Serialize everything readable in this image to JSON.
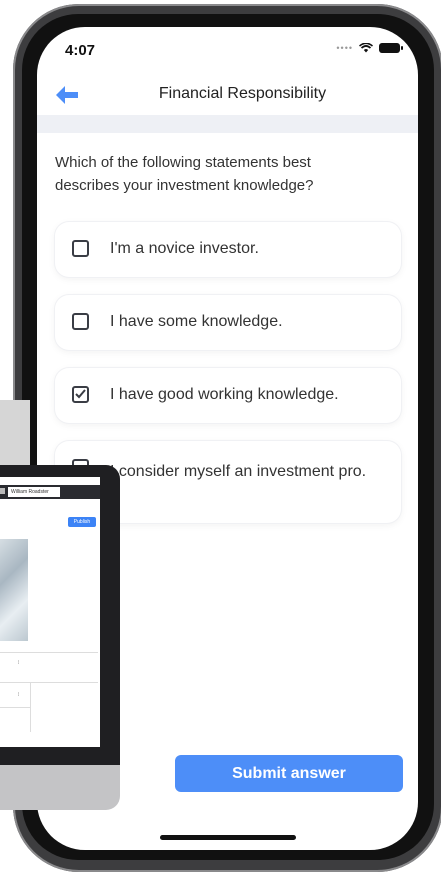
{
  "status_bar": {
    "time": "4:07"
  },
  "header": {
    "title": "Financial Responsibility"
  },
  "question": "Which of the following statements best describes your investment knowledge?",
  "options": [
    {
      "label": "I'm a novice investor.",
      "checked": false
    },
    {
      "label": "I have some knowledge.",
      "checked": false
    },
    {
      "label": "I have good working knowledge.",
      "checked": true
    },
    {
      "label": "I consider myself an investment pro.",
      "checked": false
    }
  ],
  "submit_label": "Submit answer",
  "monitor": {
    "user_label": "William Roadster",
    "publish_label": "Publish"
  },
  "colors": {
    "accent": "#4d8ef8",
    "text": "#333333",
    "divider": "#eef0f5"
  }
}
